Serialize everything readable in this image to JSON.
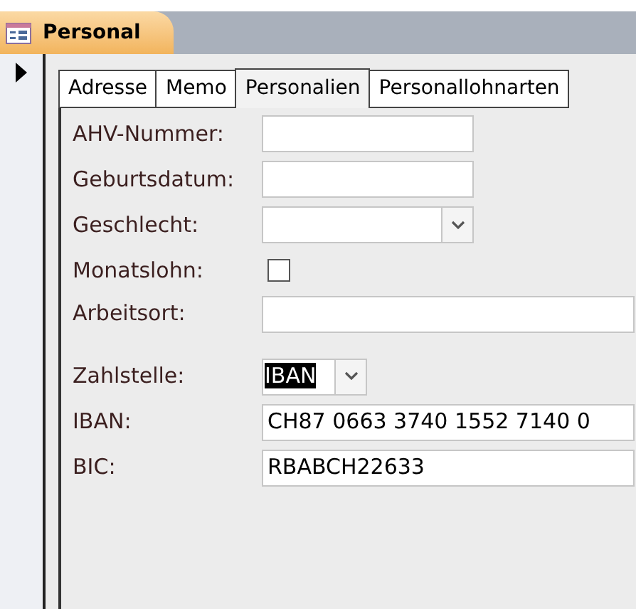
{
  "document_tab": {
    "title": "Personal",
    "selected": true
  },
  "tabs": [
    {
      "label": "Adresse",
      "selected": false
    },
    {
      "label": "Memo",
      "selected": false
    },
    {
      "label": "Personalien",
      "selected": true
    },
    {
      "label": "Personallohnarten",
      "selected": false
    }
  ],
  "fields": [
    {
      "kind": "text",
      "label": "AHV-Nummer:"
    },
    {
      "kind": "text",
      "label": "Geburtsdatum:"
    },
    {
      "kind": "combo",
      "label": "Geschlecht:"
    },
    {
      "kind": "checkbox",
      "label": "Monatslohn:",
      "checked": false
    },
    {
      "kind": "text",
      "label": "Arbeitsort:"
    },
    {
      "kind": "combo",
      "label": "Zahlstelle:",
      "value": "IBAN",
      "highlighted": true
    },
    {
      "kind": "text",
      "label": "IBAN:",
      "value": "CH87 0663 3740 1552 7140 0"
    },
    {
      "kind": "text",
      "label": "BIC:",
      "value": "RBABCH22633"
    }
  ]
}
